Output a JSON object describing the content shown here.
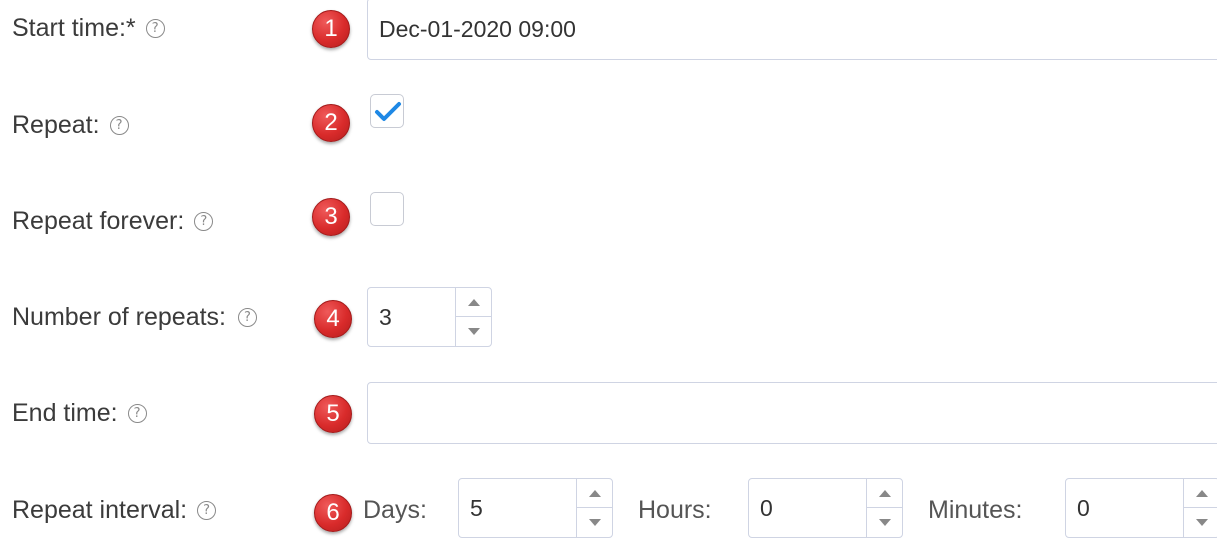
{
  "form": {
    "start_time": {
      "label": "Start time:*",
      "help_icon": "?",
      "badge": "1",
      "value": "Dec-01-2020 09:00"
    },
    "repeat": {
      "label": "Repeat:",
      "help_icon": "?",
      "badge": "2",
      "checked": true
    },
    "repeat_forever": {
      "label": "Repeat forever:",
      "help_icon": "?",
      "badge": "3",
      "checked": false
    },
    "number_of_repeats": {
      "label": "Number of repeats:",
      "help_icon": "?",
      "badge": "4",
      "value": "3"
    },
    "end_time": {
      "label": "End time:",
      "help_icon": "?",
      "badge": "5",
      "value": ""
    },
    "repeat_interval": {
      "label": "Repeat interval:",
      "help_icon": "?",
      "badge": "6",
      "days_label": "Days:",
      "days_value": "5",
      "hours_label": "Hours:",
      "hours_value": "0",
      "minutes_label": "Minutes:",
      "minutes_value": "0"
    }
  },
  "colors": {
    "badge": "#d92b2b",
    "check": "#1e88e5",
    "input_border": "#cfd4e3"
  }
}
